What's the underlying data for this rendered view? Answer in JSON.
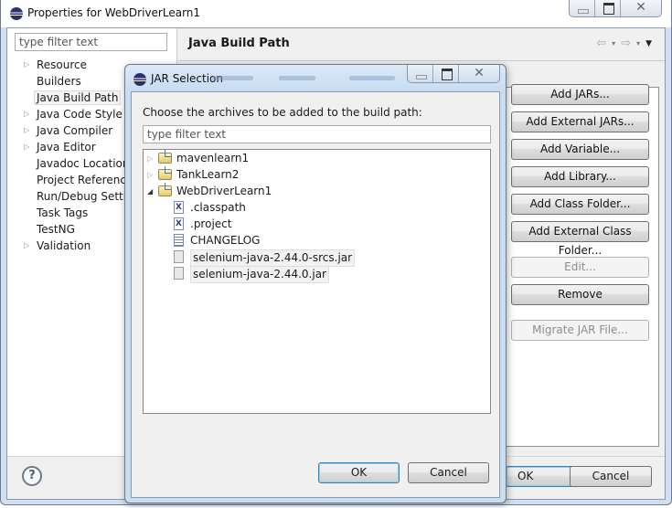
{
  "window": {
    "title": "Properties for WebDriverLearn1",
    "caption_buttons": [
      "minimize",
      "maximize",
      "close"
    ],
    "close_glyph": "✕"
  },
  "left_pane": {
    "filter_placeholder": "type filter text",
    "items": [
      {
        "label": "Resource",
        "expandable": true
      },
      {
        "label": "Builders",
        "expandable": false
      },
      {
        "label": "Java Build Path",
        "expandable": false,
        "selected": true
      },
      {
        "label": "Java Code Style",
        "expandable": true
      },
      {
        "label": "Java Compiler",
        "expandable": true
      },
      {
        "label": "Java Editor",
        "expandable": true
      },
      {
        "label": "Javadoc Location",
        "expandable": false
      },
      {
        "label": "Project References",
        "expandable": false
      },
      {
        "label": "Run/Debug Settings",
        "expandable": false
      },
      {
        "label": "Task Tags",
        "expandable": false
      },
      {
        "label": "TestNG",
        "expandable": false
      },
      {
        "label": "Validation",
        "expandable": true
      }
    ]
  },
  "page": {
    "title": "Java Build Path",
    "history": {
      "back": "⇦",
      "forward": "⇨",
      "dropdown": "▾",
      "menu": "▼"
    },
    "side_buttons": [
      {
        "label": "Add JARs...",
        "enabled": true
      },
      {
        "label": "Add External JARs...",
        "enabled": true
      },
      {
        "label": "Add Variable...",
        "enabled": true
      },
      {
        "label": "Add Library...",
        "enabled": true
      },
      {
        "label": "Add Class Folder...",
        "enabled": true
      },
      {
        "label": "Add External Class Folder...",
        "enabled": true
      },
      {
        "label": "Edit...",
        "enabled": false
      },
      {
        "label": "Remove",
        "enabled": true
      },
      {
        "label": "Migrate JAR File...",
        "enabled": false
      }
    ]
  },
  "footer": {
    "help_glyph": "?",
    "ok_label": "OK",
    "cancel_label": "Cancel"
  },
  "dialog": {
    "title": "JAR Selection",
    "message": "Choose the archives to be added to the build path:",
    "filter_placeholder": "type filter text",
    "tree": [
      {
        "label": "mavenlearn1",
        "type": "project",
        "expanded": false
      },
      {
        "label": "TankLearn2",
        "type": "project",
        "expanded": false
      },
      {
        "label": "WebDriverLearn1",
        "type": "project",
        "expanded": true
      },
      {
        "label": ".classpath",
        "type": "xml-file"
      },
      {
        "label": ".project",
        "type": "xml-file"
      },
      {
        "label": "CHANGELOG",
        "type": "text-file"
      },
      {
        "label": "selenium-java-2.44.0-srcs.jar",
        "type": "jar-file"
      },
      {
        "label": "selenium-java-2.44.0.jar",
        "type": "jar-file"
      }
    ],
    "ok_label": "OK",
    "cancel_label": "Cancel",
    "xml_glyph": "X",
    "close_glyph": "✕"
  }
}
